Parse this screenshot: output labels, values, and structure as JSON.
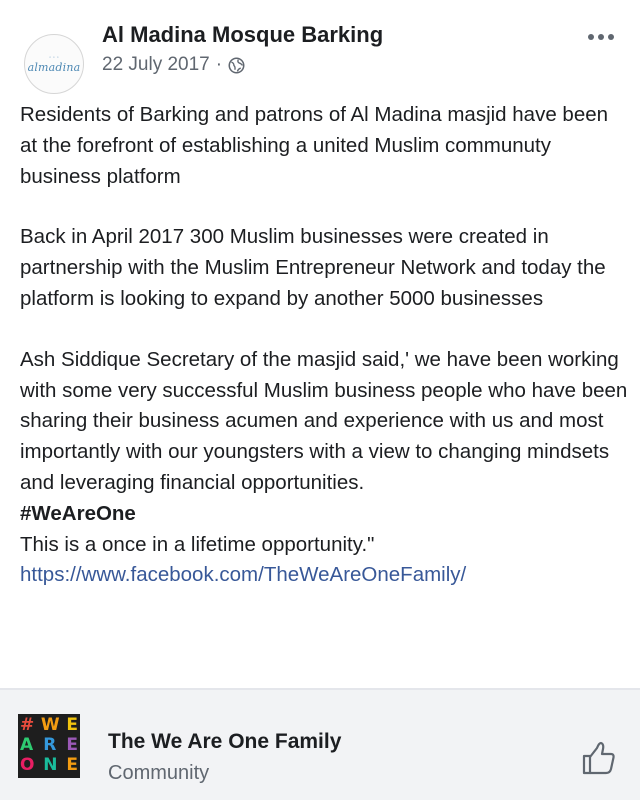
{
  "post": {
    "page_name": "Al Madina Mosque Barking",
    "avatar_text": "almadina",
    "date": "22 July 2017",
    "separator": "·",
    "privacy_icon": "globe-icon",
    "more_icon": "more-horizontal-icon",
    "paragraphs": [
      "Residents of Barking and patrons of Al Madina masjid have been at the forefront of establishing a united Muslim communuty business platform",
      "Back in April 2017 300 Muslim businesses were created in partnership with the Muslim Entrepreneur Network and today the platform is looking to expand by another 5000 businesses",
      "Ash Siddique Secretary of the masjid said,' we have been working with some very successful Muslim business people who have been sharing their business acumen and experience with us and most importantly with our youngsters with a view to changing mindsets and leveraging financial opportunities."
    ],
    "hashtag": "#WeAreOne",
    "closing": "This is a once in a lifetime opportunity.\"",
    "link": "https://www.facebook.com/TheWeAreOneFamily/"
  },
  "card": {
    "logo_rows": [
      [
        "#",
        "W",
        "E"
      ],
      [
        "A",
        "R",
        "E"
      ],
      [
        "O",
        "N",
        "E"
      ]
    ],
    "title": "The We Are One Family",
    "subtitle": "Community",
    "like_icon": "thumbs-up-icon"
  },
  "colors": {
    "link": "#385898",
    "card_bg": "#f2f3f5",
    "logo_letters": [
      "#e84c3d",
      "#f39c12",
      "#f1c40f",
      "#2ecc71",
      "#3498db",
      "#9b59b6",
      "#e91e63",
      "#1abc9c",
      "#f39c12"
    ]
  }
}
